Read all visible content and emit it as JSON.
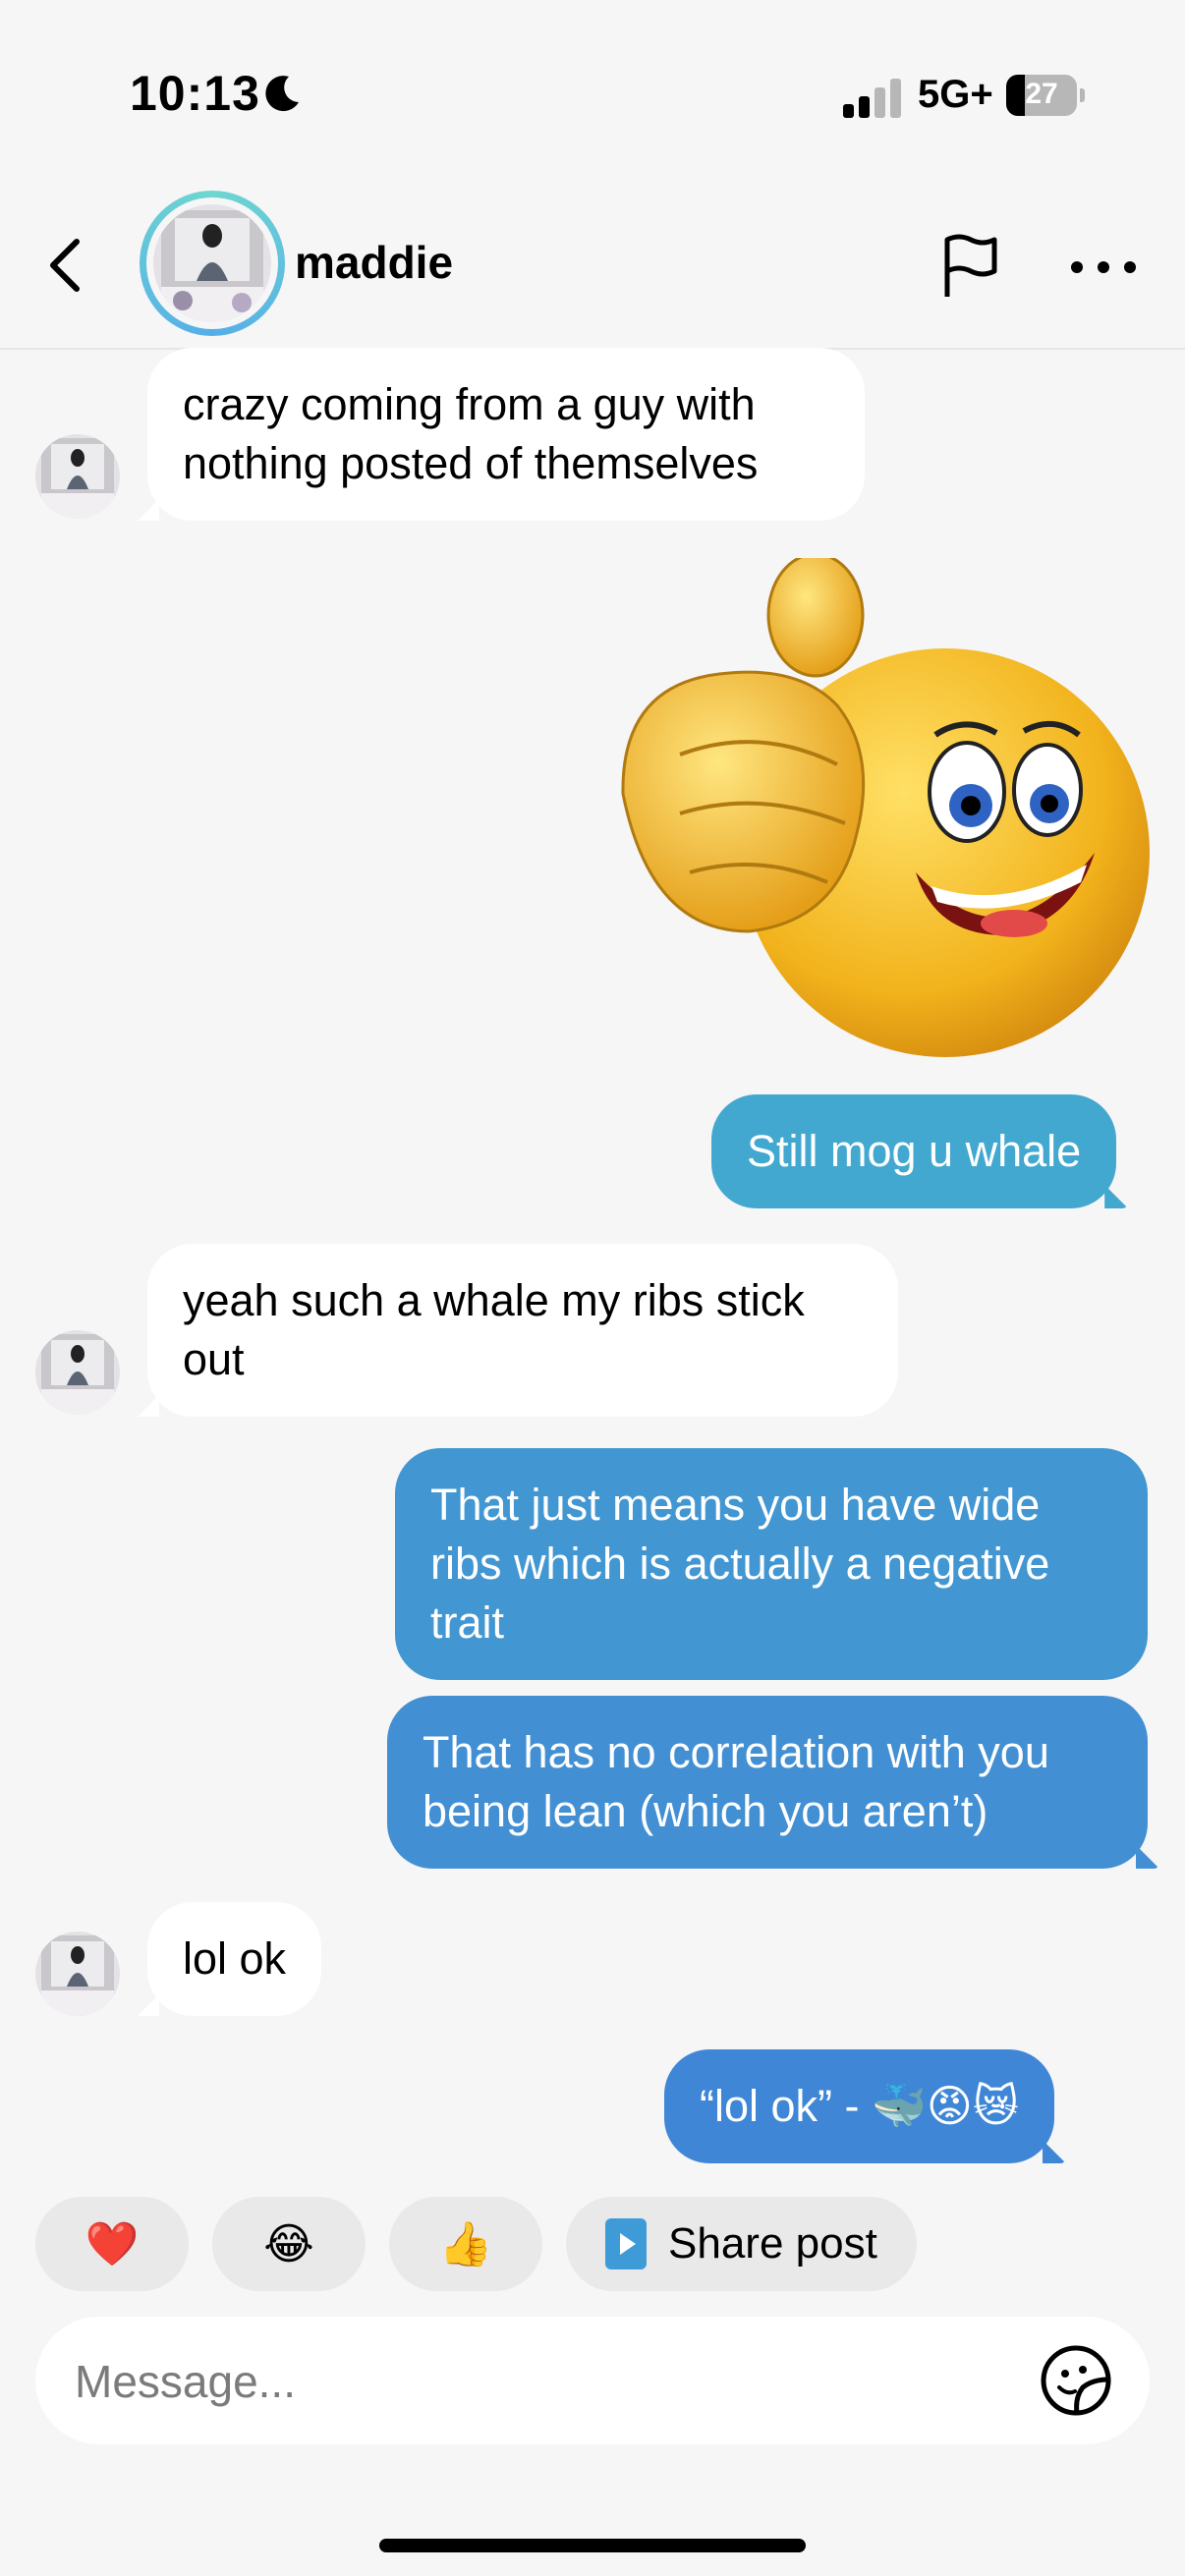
{
  "status_bar": {
    "time": "10:13",
    "focus_icon": "moon-icon",
    "signal_bars_active": 2,
    "network": "5G+",
    "battery_level": "27",
    "battery_fraction": 0.27
  },
  "header": {
    "back_icon": "chevron-left-icon",
    "contact_name": "maddie",
    "flag_icon": "flag-icon",
    "more_icon": "more-horizontal-icon"
  },
  "messages": [
    {
      "from": "them",
      "type": "text",
      "text": "crazy coming from a guy with nothing posted of themselves"
    },
    {
      "from": "me",
      "type": "sticker",
      "sticker": "thumbs-up-smiley-sticker"
    },
    {
      "from": "me",
      "type": "text",
      "text": "Still mog u whale"
    },
    {
      "from": "them",
      "type": "text",
      "text": "yeah such a whale my ribs stick out"
    },
    {
      "from": "me",
      "type": "text",
      "text": "That just means you have wide ribs which is actually a negative trait"
    },
    {
      "from": "me",
      "type": "text",
      "text": "That has no correlation with you being lean (which you aren’t)"
    },
    {
      "from": "them",
      "type": "text",
      "text": "lol ok"
    },
    {
      "from": "me",
      "type": "text",
      "text": "“lol ok” - 🐳😡😿"
    }
  ],
  "quick_replies": [
    "❤️",
    "😂",
    "👍"
  ],
  "share_post": {
    "label": "Share post",
    "icon": "play-square-icon"
  },
  "composer": {
    "placeholder": "Message...",
    "sticker_icon": "sticker-icon"
  },
  "colors": {
    "outgoing_bubble": "#3f8fd4",
    "incoming_bubble": "#ffffff",
    "background": "#f6f6f7"
  }
}
